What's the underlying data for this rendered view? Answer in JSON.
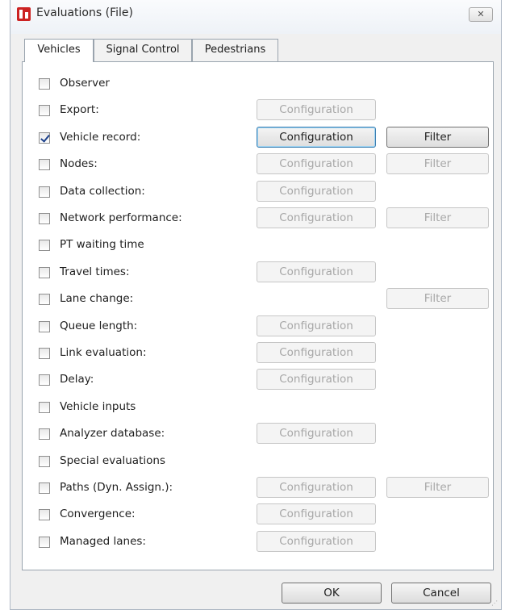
{
  "window": {
    "title": "Evaluations (File)",
    "app_icon": "vissim-app-icon",
    "close_glyph": "✕"
  },
  "tabs": [
    {
      "label": "Vehicles",
      "active": true
    },
    {
      "label": "Signal Control",
      "active": false
    },
    {
      "label": "Pedestrians",
      "active": false
    }
  ],
  "rows": [
    {
      "label": "Observer",
      "checked": false,
      "config": null,
      "filter": null
    },
    {
      "label": "Export:",
      "checked": false,
      "config": {
        "label": "Configuration",
        "enabled": false
      },
      "filter": null
    },
    {
      "label": "Vehicle record:",
      "checked": true,
      "config": {
        "label": "Configuration",
        "enabled": true,
        "focused": true
      },
      "filter": {
        "label": "Filter",
        "enabled": true
      }
    },
    {
      "label": "Nodes:",
      "checked": false,
      "config": {
        "label": "Configuration",
        "enabled": false
      },
      "filter": {
        "label": "Filter",
        "enabled": false
      }
    },
    {
      "label": "Data collection:",
      "checked": false,
      "config": {
        "label": "Configuration",
        "enabled": false
      },
      "filter": null
    },
    {
      "label": "Network performance:",
      "checked": false,
      "config": {
        "label": "Configuration",
        "enabled": false
      },
      "filter": {
        "label": "Filter",
        "enabled": false
      }
    },
    {
      "label": "PT waiting time",
      "checked": false,
      "config": null,
      "filter": null
    },
    {
      "label": "Travel times:",
      "checked": false,
      "config": {
        "label": "Configuration",
        "enabled": false
      },
      "filter": null
    },
    {
      "label": "Lane change:",
      "checked": false,
      "config": null,
      "filter": {
        "label": "Filter",
        "enabled": false
      }
    },
    {
      "label": "Queue length:",
      "checked": false,
      "config": {
        "label": "Configuration",
        "enabled": false
      },
      "filter": null
    },
    {
      "label": "Link evaluation:",
      "checked": false,
      "config": {
        "label": "Configuration",
        "enabled": false
      },
      "filter": null
    },
    {
      "label": "Delay:",
      "checked": false,
      "config": {
        "label": "Configuration",
        "enabled": false
      },
      "filter": null
    },
    {
      "label": "Vehicle inputs",
      "checked": false,
      "config": null,
      "filter": null
    },
    {
      "label": "Analyzer database:",
      "checked": false,
      "config": {
        "label": "Configuration",
        "enabled": false
      },
      "filter": null
    },
    {
      "label": "Special evaluations",
      "checked": false,
      "config": null,
      "filter": null
    },
    {
      "label": "Paths (Dyn. Assign.):",
      "checked": false,
      "config": {
        "label": "Configuration",
        "enabled": false
      },
      "filter": {
        "label": "Filter",
        "enabled": false
      }
    },
    {
      "label": "Convergence:",
      "checked": false,
      "config": {
        "label": "Configuration",
        "enabled": false
      },
      "filter": null
    },
    {
      "label": "Managed lanes:",
      "checked": false,
      "config": {
        "label": "Configuration",
        "enabled": false
      },
      "filter": null
    }
  ],
  "footer": {
    "ok_label": "OK",
    "cancel_label": "Cancel"
  }
}
